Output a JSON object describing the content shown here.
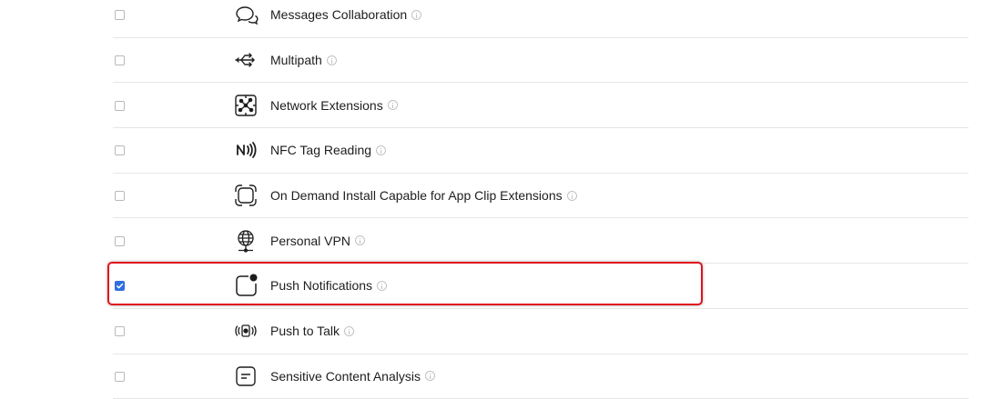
{
  "capabilities": [
    {
      "label": "Messages Collaboration",
      "checked": false,
      "icon": "messages-collaboration-icon"
    },
    {
      "label": "Multipath",
      "checked": false,
      "icon": "multipath-icon"
    },
    {
      "label": "Network Extensions",
      "checked": false,
      "icon": "network-extensions-icon"
    },
    {
      "label": "NFC Tag Reading",
      "checked": false,
      "icon": "nfc-icon"
    },
    {
      "label": "On Demand Install Capable for App Clip Extensions",
      "checked": false,
      "icon": "app-clip-icon"
    },
    {
      "label": "Personal VPN",
      "checked": false,
      "icon": "globe-vpn-icon"
    },
    {
      "label": "Push Notifications",
      "checked": true,
      "icon": "push-notifications-icon"
    },
    {
      "label": "Push to Talk",
      "checked": false,
      "icon": "push-to-talk-icon"
    },
    {
      "label": "Sensitive Content Analysis",
      "checked": false,
      "icon": "sensitive-content-icon"
    }
  ],
  "colors": {
    "accent": "#2f6fe0",
    "highlight": "#e0141e"
  }
}
